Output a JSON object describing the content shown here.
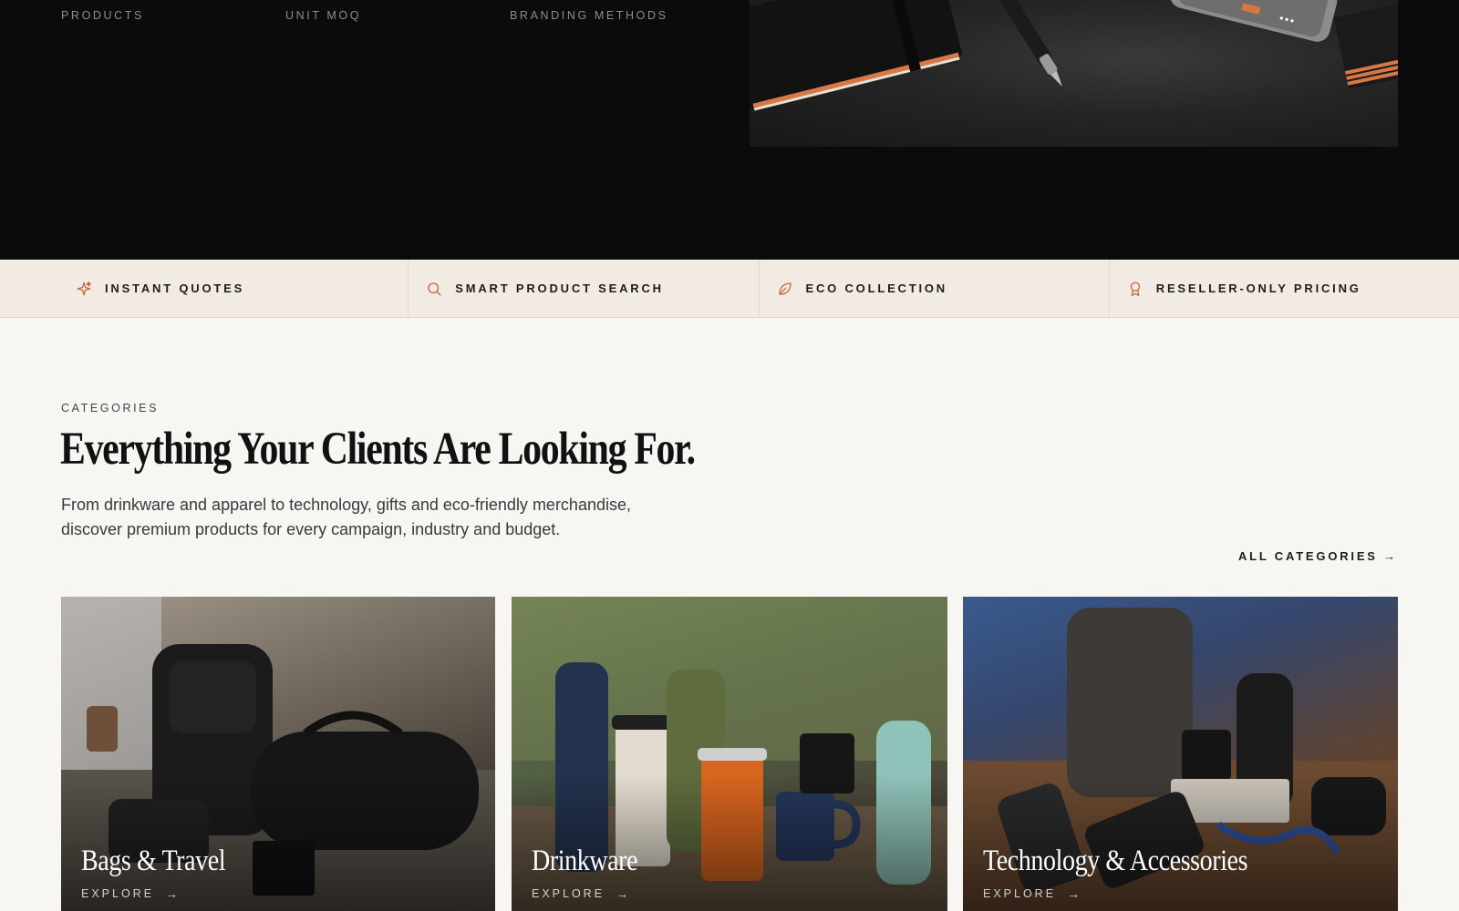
{
  "hero": {
    "stats": [
      {
        "label": "PRODUCTS"
      },
      {
        "label": "UNIT MOQ"
      },
      {
        "label": "BRANDING METHODS"
      }
    ]
  },
  "features": [
    {
      "label": "INSTANT QUOTES",
      "icon": "sparkle-icon"
    },
    {
      "label": "SMART PRODUCT SEARCH",
      "icon": "search-icon"
    },
    {
      "label": "ECO COLLECTION",
      "icon": "leaf-icon"
    },
    {
      "label": "RESELLER-ONLY PRICING",
      "icon": "award-icon"
    }
  ],
  "categories": {
    "eyebrow": "CATEGORIES",
    "headline": "Everything Your Clients Are Looking For.",
    "lede": "From drinkware and apparel to technology, gifts and eco-friendly merchandise, discover premium products for every campaign, industry and budget.",
    "all_link": "ALL CATEGORIES →",
    "cards": [
      {
        "title": "Bags & Travel",
        "cta": "EXPLORE",
        "arrow": "→"
      },
      {
        "title": "Drinkware",
        "cta": "EXPLORE",
        "arrow": "→"
      },
      {
        "title": "Technology & Accessories",
        "cta": "EXPLORE",
        "arrow": "→"
      }
    ]
  },
  "colors": {
    "accent": "#c8643a",
    "hero_bg": "#0b0b0b",
    "strip_bg": "#f2ebe4",
    "page_bg": "#f7f6f3"
  }
}
